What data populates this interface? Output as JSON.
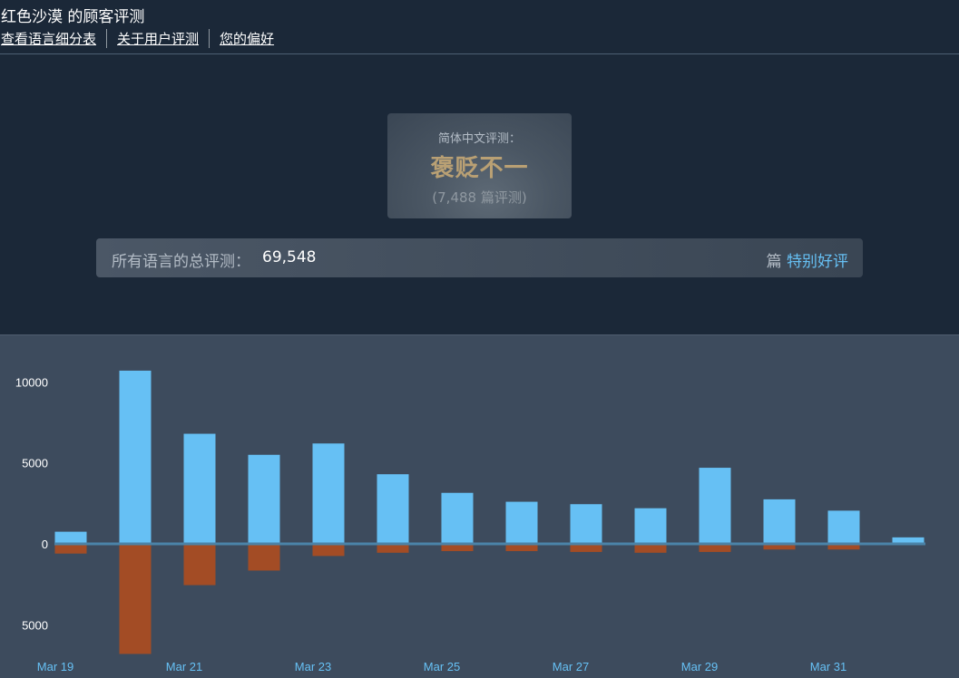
{
  "header": {
    "title": "红色沙漠 的顾客评测",
    "nav": [
      "查看语言细分表",
      "关于用户评测",
      "您的偏好"
    ]
  },
  "summary": {
    "label": "简体中文评测：",
    "rating": "褒贬不一",
    "count": "(7,488 篇评测)"
  },
  "total": {
    "label": "所有语言的总评测：",
    "value": "69,548",
    "suffix": "篇",
    "positive_label": "特别好评"
  },
  "colors": {
    "positive": "#66c0f4",
    "negative": "#a34c25",
    "axis": "#4b83a8"
  },
  "chart_data": {
    "type": "bar",
    "categories": [
      "Mar 19",
      "Mar 20",
      "Mar 21",
      "Mar 22",
      "Mar 23",
      "Mar 24",
      "Mar 25",
      "Mar 26",
      "Mar 27",
      "Mar 28",
      "Mar 29",
      "Mar 30",
      "Mar 31",
      "Apr 1"
    ],
    "x_tick_labels": [
      "Mar 19",
      "Mar 21",
      "Mar 23",
      "Mar 25",
      "Mar 27",
      "Mar 29",
      "Mar 31"
    ],
    "series": [
      {
        "values": [
          750,
          10700,
          6800,
          5500,
          6200,
          4300,
          3150,
          2600,
          2450,
          2200,
          4700,
          2750,
          2050,
          400
        ]
      },
      {
        "values": [
          -600,
          -6800,
          -2550,
          -1650,
          -750,
          -550,
          -450,
          -450,
          -500,
          -550,
          -500,
          -350,
          -350,
          -50
        ]
      }
    ],
    "y_tick_labels": [
      "10000",
      "5000",
      "0",
      "5000"
    ],
    "ylim": [
      -7000,
      11000
    ]
  }
}
